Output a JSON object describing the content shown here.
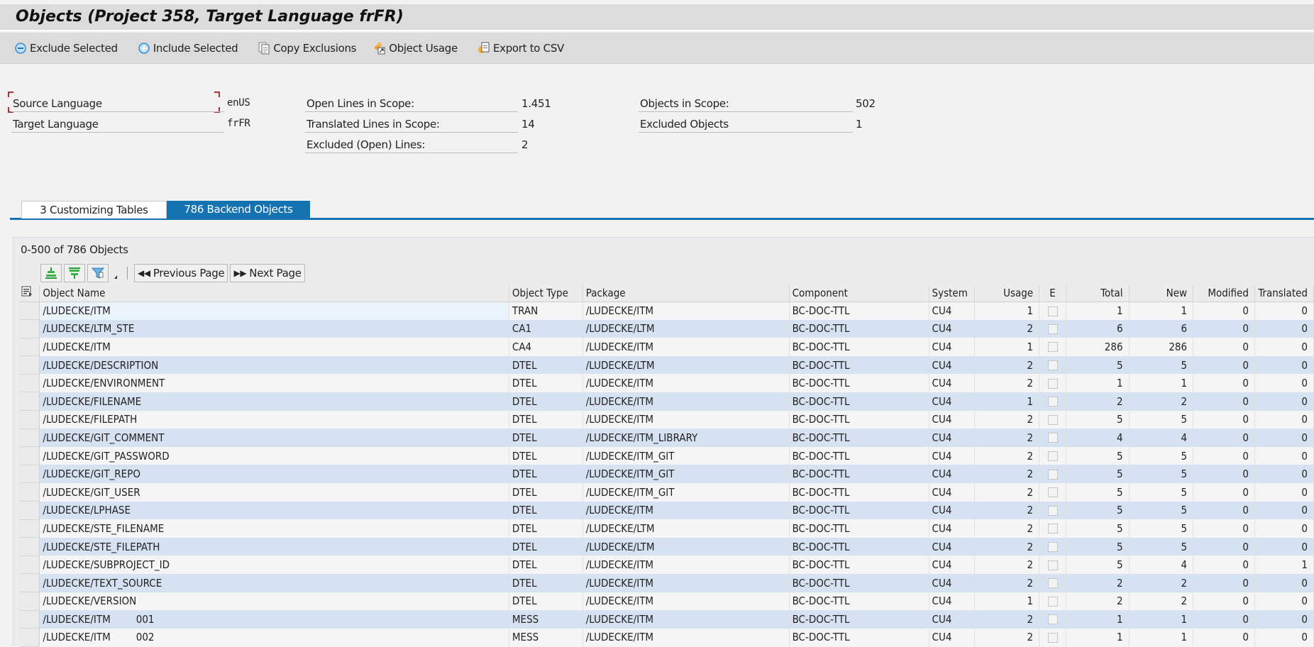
{
  "title": "Objects (Project 358, Target Language frFR)",
  "toolbar": [
    {
      "label": "Exclude Selected",
      "icon": "minus-circle-icon"
    },
    {
      "label": "Include Selected",
      "icon": "plus-circle-icon"
    },
    {
      "label": "Copy Exclusions",
      "icon": "copy-document-icon"
    },
    {
      "label": "Object Usage",
      "icon": "object-usage-icon"
    },
    {
      "label": "Export to CSV",
      "icon": "export-csv-icon"
    }
  ],
  "info": {
    "source_language_label": "Source Language",
    "source_language_value": "enUS",
    "target_language_label": "Target Language",
    "target_language_value": "frFR",
    "open_lines_label": "Open Lines in Scope:",
    "open_lines_value": "1.451",
    "translated_lines_label": "Translated Lines in Scope:",
    "translated_lines_value": "14",
    "excluded_lines_label": "Excluded (Open) Lines:",
    "excluded_lines_value": "2",
    "objects_in_scope_label": "Objects in Scope:",
    "objects_in_scope_value": "502",
    "excluded_objects_label": "Excluded Objects",
    "excluded_objects_value": "1"
  },
  "tabs": [
    {
      "label": "3  Customizing Tables",
      "active": false
    },
    {
      "label": "786  Backend Objects",
      "active": true
    }
  ],
  "grid": {
    "count_text": "0-500 of 786 Objects",
    "prev_page": "Previous Page",
    "next_page": "Next Page",
    "columns": [
      "Object Name",
      "Object Type",
      "Package",
      "Component",
      "System",
      "Usage",
      "E",
      "Total",
      "New",
      "Modified",
      "Translated"
    ],
    "rows": [
      {
        "name": "/LUDECKE/ITM",
        "suffix": "",
        "type": "TRAN",
        "package": "/LUDECKE/ITM",
        "component": "BC-DOC-TTL",
        "system": "CU4",
        "usage": "1",
        "excluded": false,
        "total": "1",
        "new": "1",
        "modified": "0",
        "translated": "0"
      },
      {
        "name": "/LUDECKE/LTM_STE",
        "suffix": "",
        "type": "CA1",
        "package": "/LUDECKE/LTM",
        "component": "BC-DOC-TTL",
        "system": "CU4",
        "usage": "2",
        "excluded": false,
        "total": "6",
        "new": "6",
        "modified": "0",
        "translated": "0"
      },
      {
        "name": "/LUDECKE/ITM",
        "suffix": "",
        "type": "CA4",
        "package": "/LUDECKE/ITM",
        "component": "BC-DOC-TTL",
        "system": "CU4",
        "usage": "1",
        "excluded": false,
        "total": "286",
        "new": "286",
        "modified": "0",
        "translated": "0"
      },
      {
        "name": "/LUDECKE/DESCRIPTION",
        "suffix": "",
        "type": "DTEL",
        "package": "/LUDECKE/LTM",
        "component": "BC-DOC-TTL",
        "system": "CU4",
        "usage": "2",
        "excluded": false,
        "total": "5",
        "new": "5",
        "modified": "0",
        "translated": "0"
      },
      {
        "name": "/LUDECKE/ENVIRONMENT",
        "suffix": "",
        "type": "DTEL",
        "package": "/LUDECKE/ITM",
        "component": "BC-DOC-TTL",
        "system": "CU4",
        "usage": "2",
        "excluded": false,
        "total": "1",
        "new": "1",
        "modified": "0",
        "translated": "0"
      },
      {
        "name": "/LUDECKE/FILENAME",
        "suffix": "",
        "type": "DTEL",
        "package": "/LUDECKE/ITM",
        "component": "BC-DOC-TTL",
        "system": "CU4",
        "usage": "1",
        "excluded": false,
        "total": "2",
        "new": "2",
        "modified": "0",
        "translated": "0"
      },
      {
        "name": "/LUDECKE/FILEPATH",
        "suffix": "",
        "type": "DTEL",
        "package": "/LUDECKE/ITM",
        "component": "BC-DOC-TTL",
        "system": "CU4",
        "usage": "2",
        "excluded": false,
        "total": "5",
        "new": "5",
        "modified": "0",
        "translated": "0"
      },
      {
        "name": "/LUDECKE/GIT_COMMENT",
        "suffix": "",
        "type": "DTEL",
        "package": "/LUDECKE/ITM_LIBRARY",
        "component": "BC-DOC-TTL",
        "system": "CU4",
        "usage": "2",
        "excluded": false,
        "total": "4",
        "new": "4",
        "modified": "0",
        "translated": "0"
      },
      {
        "name": "/LUDECKE/GIT_PASSWORD",
        "suffix": "",
        "type": "DTEL",
        "package": "/LUDECKE/ITM_GIT",
        "component": "BC-DOC-TTL",
        "system": "CU4",
        "usage": "2",
        "excluded": false,
        "total": "5",
        "new": "5",
        "modified": "0",
        "translated": "0"
      },
      {
        "name": "/LUDECKE/GIT_REPO",
        "suffix": "",
        "type": "DTEL",
        "package": "/LUDECKE/ITM_GIT",
        "component": "BC-DOC-TTL",
        "system": "CU4",
        "usage": "2",
        "excluded": false,
        "total": "5",
        "new": "5",
        "modified": "0",
        "translated": "0"
      },
      {
        "name": "/LUDECKE/GIT_USER",
        "suffix": "",
        "type": "DTEL",
        "package": "/LUDECKE/ITM_GIT",
        "component": "BC-DOC-TTL",
        "system": "CU4",
        "usage": "2",
        "excluded": false,
        "total": "5",
        "new": "5",
        "modified": "0",
        "translated": "0"
      },
      {
        "name": "/LUDECKE/LPHASE",
        "suffix": "",
        "type": "DTEL",
        "package": "/LUDECKE/ITM",
        "component": "BC-DOC-TTL",
        "system": "CU4",
        "usage": "2",
        "excluded": false,
        "total": "5",
        "new": "5",
        "modified": "0",
        "translated": "0"
      },
      {
        "name": "/LUDECKE/STE_FILENAME",
        "suffix": "",
        "type": "DTEL",
        "package": "/LUDECKE/LTM",
        "component": "BC-DOC-TTL",
        "system": "CU4",
        "usage": "2",
        "excluded": false,
        "total": "5",
        "new": "5",
        "modified": "0",
        "translated": "0"
      },
      {
        "name": "/LUDECKE/STE_FILEPATH",
        "suffix": "",
        "type": "DTEL",
        "package": "/LUDECKE/LTM",
        "component": "BC-DOC-TTL",
        "system": "CU4",
        "usage": "2",
        "excluded": false,
        "total": "5",
        "new": "5",
        "modified": "0",
        "translated": "0"
      },
      {
        "name": "/LUDECKE/SUBPROJECT_ID",
        "suffix": "",
        "type": "DTEL",
        "package": "/LUDECKE/ITM",
        "component": "BC-DOC-TTL",
        "system": "CU4",
        "usage": "2",
        "excluded": false,
        "total": "5",
        "new": "4",
        "modified": "0",
        "translated": "1"
      },
      {
        "name": "/LUDECKE/TEXT_SOURCE",
        "suffix": "",
        "type": "DTEL",
        "package": "/LUDECKE/ITM",
        "component": "BC-DOC-TTL",
        "system": "CU4",
        "usage": "2",
        "excluded": false,
        "total": "2",
        "new": "2",
        "modified": "0",
        "translated": "0"
      },
      {
        "name": "/LUDECKE/VERSION",
        "suffix": "",
        "type": "DTEL",
        "package": "/LUDECKE/ITM",
        "component": "BC-DOC-TTL",
        "system": "CU4",
        "usage": "1",
        "excluded": false,
        "total": "2",
        "new": "2",
        "modified": "0",
        "translated": "0"
      },
      {
        "name": "/LUDECKE/ITM",
        "suffix": "001",
        "type": "MESS",
        "package": "/LUDECKE/ITM",
        "component": "BC-DOC-TTL",
        "system": "CU4",
        "usage": "2",
        "excluded": false,
        "total": "1",
        "new": "1",
        "modified": "0",
        "translated": "0"
      },
      {
        "name": "/LUDECKE/ITM",
        "suffix": "002",
        "type": "MESS",
        "package": "/LUDECKE/ITM",
        "component": "BC-DOC-TTL",
        "system": "CU4",
        "usage": "2",
        "excluded": false,
        "total": "1",
        "new": "1",
        "modified": "0",
        "translated": "0"
      }
    ]
  },
  "colors": {
    "accent": "#1573b1",
    "row_alt": "#d6e2f1",
    "row": "#f5f5f5",
    "bar_bg": "#dcdcdc"
  }
}
